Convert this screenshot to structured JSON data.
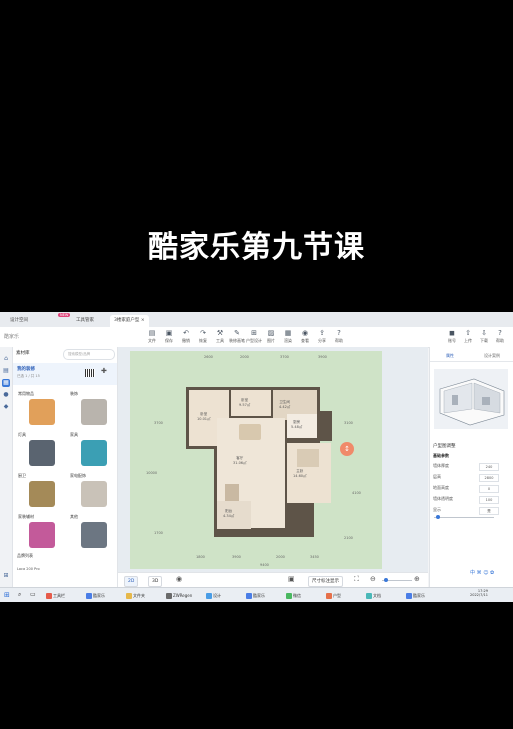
{
  "caption": "酷家乐第九节课",
  "browser": {
    "tabs": [
      "设计空间",
      "工具管家",
      "3楼家庭户型"
    ],
    "new_badge": "NEW",
    "close": "×"
  },
  "app": {
    "logo": "酷家乐",
    "toolbar": [
      {
        "icon": "file-icon",
        "glyph": "▤",
        "label": "文件"
      },
      {
        "icon": "save-icon",
        "glyph": "▣",
        "label": "保存"
      },
      {
        "icon": "undo-icon",
        "glyph": "↶",
        "label": "撤销"
      },
      {
        "icon": "redo-icon",
        "glyph": "↷",
        "label": "恢复"
      },
      {
        "icon": "wrench-icon",
        "glyph": "⚒",
        "label": "工具"
      },
      {
        "icon": "decor-icon",
        "glyph": "✎",
        "label": "装修画笔"
      },
      {
        "icon": "layout-icon",
        "glyph": "⊞",
        "label": "户型设计"
      },
      {
        "icon": "image-icon",
        "glyph": "▨",
        "label": "图片"
      },
      {
        "icon": "render-icon",
        "glyph": "▦",
        "label": "渲染"
      },
      {
        "icon": "eye-icon",
        "glyph": "◉",
        "label": "查看"
      },
      {
        "icon": "share-icon",
        "glyph": "⇪",
        "label": "分享"
      },
      {
        "icon": "help-icon",
        "glyph": "?",
        "label": "帮助"
      }
    ],
    "right_icons": [
      {
        "icon": "account-icon",
        "glyph": "◼",
        "label": "账号"
      },
      {
        "icon": "upload-icon",
        "glyph": "⇧",
        "label": "上传"
      },
      {
        "icon": "download-icon",
        "glyph": "⇩",
        "label": "下载"
      },
      {
        "icon": "question-icon",
        "glyph": "?",
        "label": "帮助"
      }
    ]
  },
  "left_panel": {
    "header": "素材库",
    "search_placeholder": "搜索模型/品牌",
    "my_designs": "我的装修",
    "sub": "已选 1 / 共 15",
    "categories": [
      {
        "label": "常用物品",
        "color": "#e1a05a"
      },
      {
        "label": "装饰",
        "color": "#b9b4ad"
      },
      {
        "label": "灯具",
        "color": "#5a6470"
      },
      {
        "label": "家具",
        "color": "#3b9fb4"
      },
      {
        "label": "厨卫",
        "color": "#a48a58"
      },
      {
        "label": "家电配饰",
        "color": "#c9c2b8"
      },
      {
        "label": "家装辅材",
        "color": "#c35a9a"
      },
      {
        "label": "其他",
        "color": "#6c7682"
      }
    ],
    "footer_label": "品牌列表",
    "footer_values": [
      "Loca",
      "200",
      "Pro"
    ]
  },
  "canvas": {
    "dims_top": [
      "2600",
      "2000",
      "3700",
      "3900"
    ],
    "dims_bottom": [
      "1800",
      "3900",
      "2000",
      "3450"
    ],
    "dims_total_bottom": "9400",
    "dims_left": [
      "3700",
      "10000",
      "1700"
    ],
    "dims_right": [
      "3100",
      "4100",
      "2100"
    ],
    "rooms": [
      {
        "name": "卧室",
        "area": "10.01㎡"
      },
      {
        "name": "卧室",
        "area": "9.57㎡"
      },
      {
        "name": "客厅",
        "area": "31.06㎡"
      },
      {
        "name": "卫生间",
        "area": "4.42㎡"
      },
      {
        "name": "主卧",
        "area": "14.60㎡"
      },
      {
        "name": "阳台",
        "area": "4.34㎡"
      },
      {
        "name": "厨房",
        "area": "5.48㎡"
      }
    ]
  },
  "bottom_bar": {
    "view_2d": "2D",
    "view_3d": "3D",
    "ruler": "尺寸标注显示",
    "zoom": "100%"
  },
  "right_panel": {
    "tabs": [
      "属性",
      "设计案例"
    ],
    "section": "户型图调整",
    "subsection": "基础参数",
    "rows": [
      {
        "label": "墙体厚度",
        "value": "240"
      },
      {
        "label": "层高",
        "value": "2800"
      },
      {
        "label": "地面高度",
        "value": "0"
      },
      {
        "label": "墙体透明度",
        "value": "100"
      },
      {
        "label": "显示",
        "value": "是"
      }
    ],
    "footer": [
      "中",
      "⌘",
      "☺",
      "✿"
    ]
  },
  "taskbar": {
    "apps": [
      {
        "label": "工具栏",
        "color": "#e65b4a"
      },
      {
        "label": "酷家乐",
        "color": "#4a7de6"
      },
      {
        "label": "文件夹",
        "color": "#e6b84a"
      },
      {
        "label": "ZWRegen",
        "color": "#6a6a6a"
      },
      {
        "label": "设计",
        "color": "#4a9de6"
      },
      {
        "label": "酷家乐",
        "color": "#4a7de6"
      },
      {
        "label": "微信",
        "color": "#4ab860"
      },
      {
        "label": "户型",
        "color": "#e6704a"
      },
      {
        "label": "文档",
        "color": "#4ab8b8"
      },
      {
        "label": "酷家乐",
        "color": "#4a7de6"
      }
    ],
    "time": "17:29",
    "date": "2022/7/11"
  }
}
